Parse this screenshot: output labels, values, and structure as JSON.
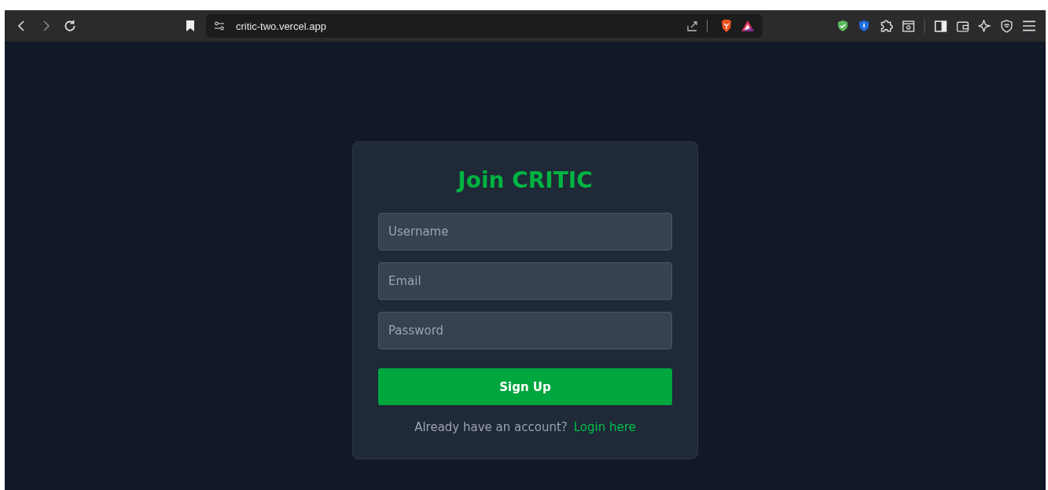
{
  "browser": {
    "url": "critic-two.vercel.app"
  },
  "form": {
    "title": "Join CRITIC",
    "fields": [
      {
        "placeholder": "Username"
      },
      {
        "placeholder": "Email"
      },
      {
        "placeholder": "Password"
      }
    ],
    "submit": "Sign Up",
    "prompt": "Already have an account?",
    "link": "Login here"
  }
}
